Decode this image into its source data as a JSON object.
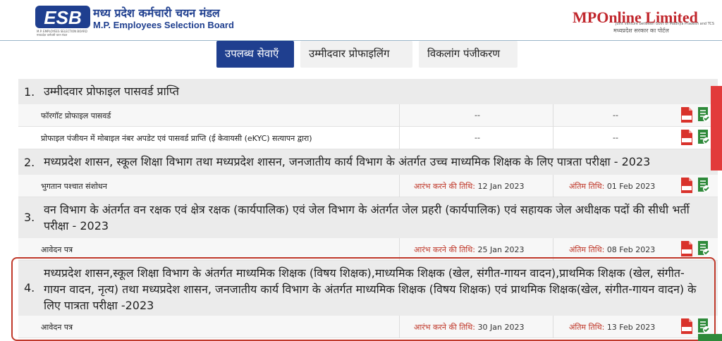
{
  "header": {
    "logo_text": "ESB",
    "logo_caption": "M.P. EMPLOYEES SELECTION BOARD मध्यप्रदेश कर्मचारी चयन मंडल",
    "org_name_hi": "मध्य प्रदेश कर्मचारी चयन मंडल",
    "org_name_en": "M.P. Employees Selection Board",
    "portal_logo": "MPOnline Limited",
    "portal_tagline_en": "Joint venture between Govt of Madhya Pradesh and TCS",
    "portal_tagline_hi": "मध्यप्रदेश सरकार का पोर्टल"
  },
  "tabs": [
    {
      "label": "उपलब्ध सेवाएँ",
      "active": true
    },
    {
      "label": "उम्मीदवार प्रोफाइलिंग",
      "active": false
    },
    {
      "label": "विकलांग पंजीकरण",
      "active": false
    }
  ],
  "start_label": "आरंभ करने की तिथि:",
  "end_label": "अंतिम तिथि:",
  "sections": [
    {
      "number": "1.",
      "title": "उम्मीदवार प्रोफाइल पासवर्ड प्राप्ति",
      "rows": [
        {
          "label": "फॉरगॉट प्रोफाइल पासवर्ड",
          "start": "--",
          "end": "--"
        },
        {
          "label": "प्रोफाइल पंजीयन में मोबाइल नंबर अपडेट एवं पासवर्ड प्राप्ति (ई केवायसी (eKYC) सत्यापन द्वारा)",
          "start": "--",
          "end": "--"
        }
      ]
    },
    {
      "number": "2.",
      "title": "मध्यप्रदेश शासन, स्कूल शिक्षा विभाग तथा मध्यप्रदेश शासन, जनजातीय कार्य विभाग के अंतर्गत उच्च माध्यमिक शिक्षक के लिए पात्रता परीक्षा - 2023",
      "rows": [
        {
          "label": "भुगतान पश्चात संशोधन",
          "start": "12 Jan 2023",
          "end": "01 Feb 2023"
        }
      ]
    },
    {
      "number": "3.",
      "title": "वन विभाग के अंतर्गत वन रक्षक एवं क्षेत्र रक्षक (कार्यपालिक) एवं जेल विभाग के अंतर्गत जेल प्रहरी (कार्यपालिक) एवं सहायक जेल अधीक्षक पदों की सीधी भर्ती परीक्षा - 2023",
      "rows": [
        {
          "label": "आवेदन पत्र",
          "start": "25 Jan 2023",
          "end": "08 Feb 2023"
        }
      ]
    },
    {
      "number": "4.",
      "title": "मध्यप्रदेश शासन,स्कूल शिक्षा विभाग के अंतर्गत माध्यमिक शिक्षक (विषय शिक्षक),माध्यमिक शिक्षक (खेल, संगीत-गायन वादन),प्राथमिक शिक्षक (खेल, संगीत-गायन वादन, नृत्य) तथा मध्यप्रदेश शासन, जनजातीय कार्य विभाग के अंतर्गत माध्यमिक शिक्षक (विषय शिक्षक) एवं प्राथमिक शिक्षक(खेल, संगीत-गायन वादन) के लिए पात्रता परीक्षा -2023",
      "rows": [
        {
          "label": "आवेदन पत्र",
          "start": "30 Jan 2023",
          "end": "13 Feb 2023"
        }
      ]
    }
  ],
  "icons": {
    "pdf": "pdf-icon",
    "apply": "apply-checklist-icon"
  },
  "colors": {
    "brand_blue": "#1f3f8f",
    "date_label_red": "#c0392b",
    "highlight": "#c0392b",
    "apply_green": "#2e8a3a"
  }
}
